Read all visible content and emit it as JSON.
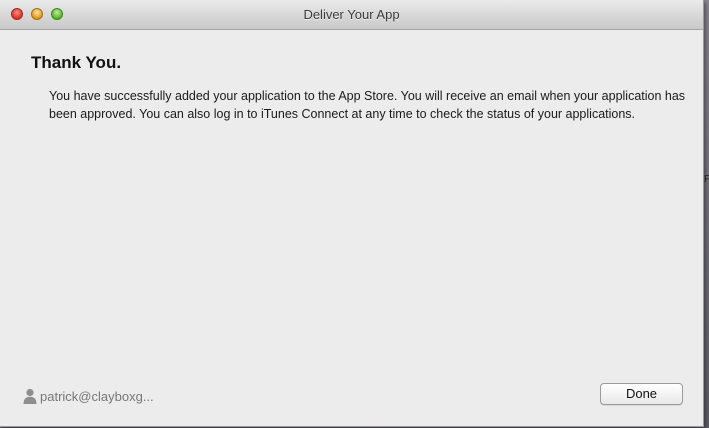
{
  "window": {
    "title": "Deliver Your App"
  },
  "content": {
    "heading": "Thank You.",
    "message": "You have successfully added your application to the App Store. You will receive an email when your application has been approved. You can also log in to iTunes Connect at any time to check the status of your applications."
  },
  "footer": {
    "account": "patrick@clayboxg...",
    "account_icon": "user-icon",
    "done_label": "Done"
  },
  "background": {
    "edge_text": "F"
  },
  "colors": {
    "close": "#e0443a",
    "minimize": "#e5a832",
    "zoom": "#6cbf3f"
  }
}
